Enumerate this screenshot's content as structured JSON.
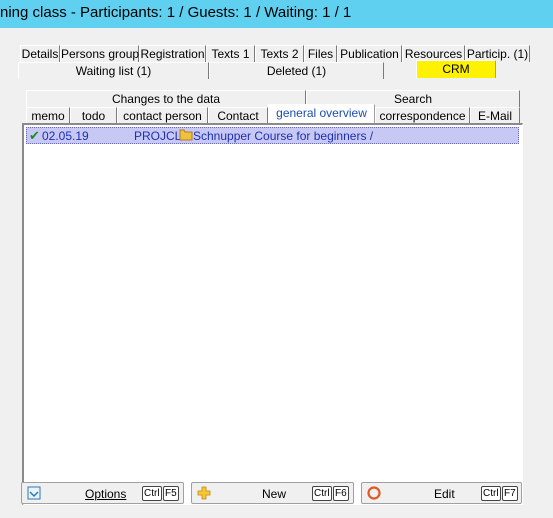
{
  "window": {
    "title": "ning class - Participants: 1 / Guests: 1 / Waiting: 1 / 1"
  },
  "tabs_row1": [
    "Details",
    "Persons group",
    "Registration",
    "Texts 1",
    "Texts 2",
    "Files",
    "Publication",
    "Resources",
    "Particip. (1)"
  ],
  "tabs_row2": [
    "Waiting list (1)",
    "Deleted (1)",
    "CRM"
  ],
  "tabs_row3": [
    "Changes to the data",
    "Search"
  ],
  "tabs_row4": [
    "memo",
    "todo",
    "contact person",
    "Contact",
    "general overview",
    "correspondence",
    "E-Mail"
  ],
  "list": [
    {
      "date": "02.05.19",
      "code": "PROJCL",
      "text": "Schnupper Course for beginners /"
    }
  ],
  "buttons": {
    "options": {
      "label": "Options",
      "key1": "Ctrl",
      "key2": "F5"
    },
    "new": {
      "label": "New",
      "key1": "Ctrl",
      "key2": "F6"
    },
    "edit": {
      "label": "Edit",
      "key1": "Ctrl",
      "key2": "F7"
    }
  },
  "colors": {
    "titlebar": "#5fd0f0",
    "crm_tab": "#fff200",
    "row_highlight": "#c8c8f4",
    "link_text": "#1c30b0"
  }
}
